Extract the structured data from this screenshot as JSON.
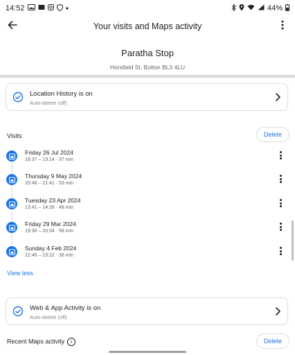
{
  "status_bar": {
    "time": "14:52",
    "battery": "44%",
    "left_icons": [
      "gallery-icon",
      "wallet-icon",
      "instagram-icon",
      "shield-icon",
      "notification-icon"
    ],
    "right_icons": [
      "bluetooth-icon",
      "location-icon",
      "wifi-icon",
      "signal-icon",
      "battery-icon"
    ]
  },
  "appbar": {
    "title": "Your visits and Maps activity"
  },
  "place": {
    "name": "Paratha Stop",
    "address": "Horsfield St, Bolton BL3 4LU"
  },
  "location_history": {
    "title": "Location History is on",
    "subtitle": "Auto-delete (off)"
  },
  "visits": {
    "section_title": "Visits",
    "delete_label": "Delete",
    "items": [
      {
        "date": "Friday 26 Jul 2024",
        "time": "18:37 – 19:14 · 37 min"
      },
      {
        "date": "Thursday 9 May 2024",
        "time": "20:48 – 21:41 · 53 min"
      },
      {
        "date": "Tuesday 23 Apr 2024",
        "time": "13:41 – 14:28 · 48 min"
      },
      {
        "date": "Friday 29 Mar 2024",
        "time": "19:36 – 20:34 · 58 min"
      },
      {
        "date": "Sunday 4 Feb 2024",
        "time": "22:46 – 23:22 · 36 min"
      }
    ],
    "view_less_label": "View less"
  },
  "web_app_activity": {
    "title": "Web & App Activity is on",
    "subtitle": "Auto-delete (off)"
  },
  "recent_maps": {
    "section_title": "Recent Maps activity",
    "delete_label": "Delete"
  },
  "colors": {
    "accent": "#1a73e8",
    "divider": "#dadce0",
    "text_primary": "#202124",
    "text_secondary": "#5f6368"
  }
}
